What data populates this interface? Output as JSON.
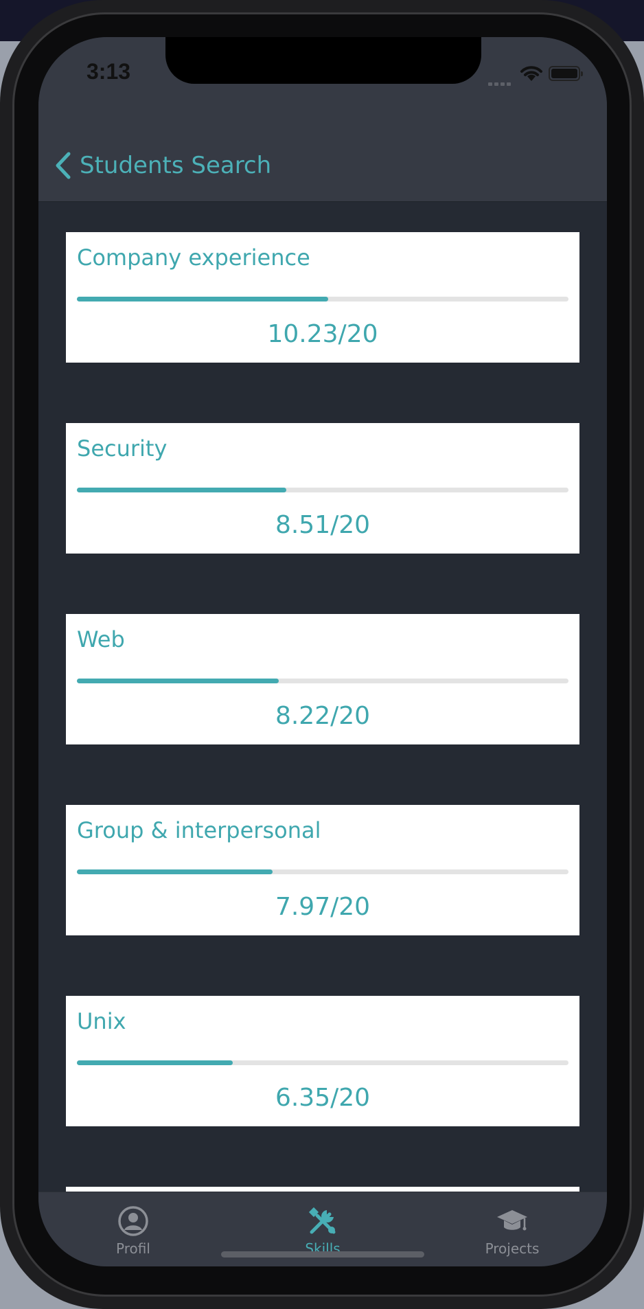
{
  "status_bar": {
    "time": "3:13"
  },
  "nav": {
    "back_label": "Students Search"
  },
  "skills": [
    {
      "name": "Company experience",
      "score_text": "10.23/20",
      "level": 0.5115
    },
    {
      "name": "Security",
      "score_text": "8.51/20",
      "level": 0.4255
    },
    {
      "name": "Web",
      "score_text": "8.22/20",
      "level": 0.411
    },
    {
      "name": "Group & interpersonal",
      "score_text": "7.97/20",
      "level": 0.3985
    },
    {
      "name": "Unix",
      "score_text": "6.35/20",
      "level": 0.3175
    }
  ],
  "tabs": [
    {
      "label": "Profil",
      "icon": "person-circle-icon",
      "active": false
    },
    {
      "label": "Skills",
      "icon": "tools-icon",
      "active": true
    },
    {
      "label": "Projects",
      "icon": "graduation-cap-icon",
      "active": false
    }
  ],
  "colors": {
    "accent": "#43aab1",
    "nav_bg": "#363a44",
    "content_bg": "#252a33"
  }
}
